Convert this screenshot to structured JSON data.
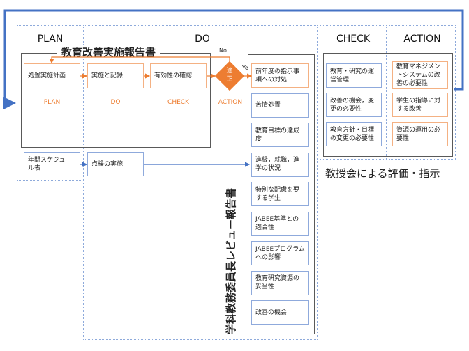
{
  "columns": {
    "plan": "PLAN",
    "do": "DO",
    "check": "CHECK",
    "action": "ACTION"
  },
  "report_title": "教育改善実施報告書",
  "flow": {
    "steps": [
      "処置実施計画",
      "実施と記録",
      "有効性の確認"
    ],
    "phase_labels": [
      "PLAN",
      "DO",
      "CHECK",
      "ACTION"
    ],
    "decision": "適正",
    "no_label": "No",
    "yes_label": "Yes"
  },
  "schedule": {
    "annual": "年間スケジュール表",
    "inspection": "点検の実施"
  },
  "review_title": "学科教務委員長レビュー報告書",
  "review_items": [
    {
      "label": "前年度の指示事項への対処",
      "color": "orange"
    },
    {
      "label": "苦情処置",
      "color": "blue"
    },
    {
      "label": "教育目標の達成度",
      "color": "blue"
    },
    {
      "label": "進級，就職，進学の状況",
      "color": "blue"
    },
    {
      "label": "特別な配慮を要する学生",
      "color": "blue"
    },
    {
      "label": "JABEE基準との適合性",
      "color": "blue"
    },
    {
      "label": "JABEEプログラムへの影響",
      "color": "blue"
    },
    {
      "label": "教育研究資源の妥当性",
      "color": "blue"
    },
    {
      "label": "改善の機会",
      "color": "blue"
    }
  ],
  "check_items": [
    "教育・研究の運営管理",
    "改善の機会，変更の必要性",
    "教育方針・目標の変更の必要性"
  ],
  "action_items": [
    "教育マネジメントシステムの改善の必要性",
    "学生の指導に対する改善",
    "資源の運用の必要性"
  ],
  "faculty_caption": "教授会による評価・指示",
  "colors": {
    "orange": "#ed7d31",
    "orange_light": "#f4b183",
    "blue": "#4472c4",
    "blue_light": "#8faadc"
  }
}
